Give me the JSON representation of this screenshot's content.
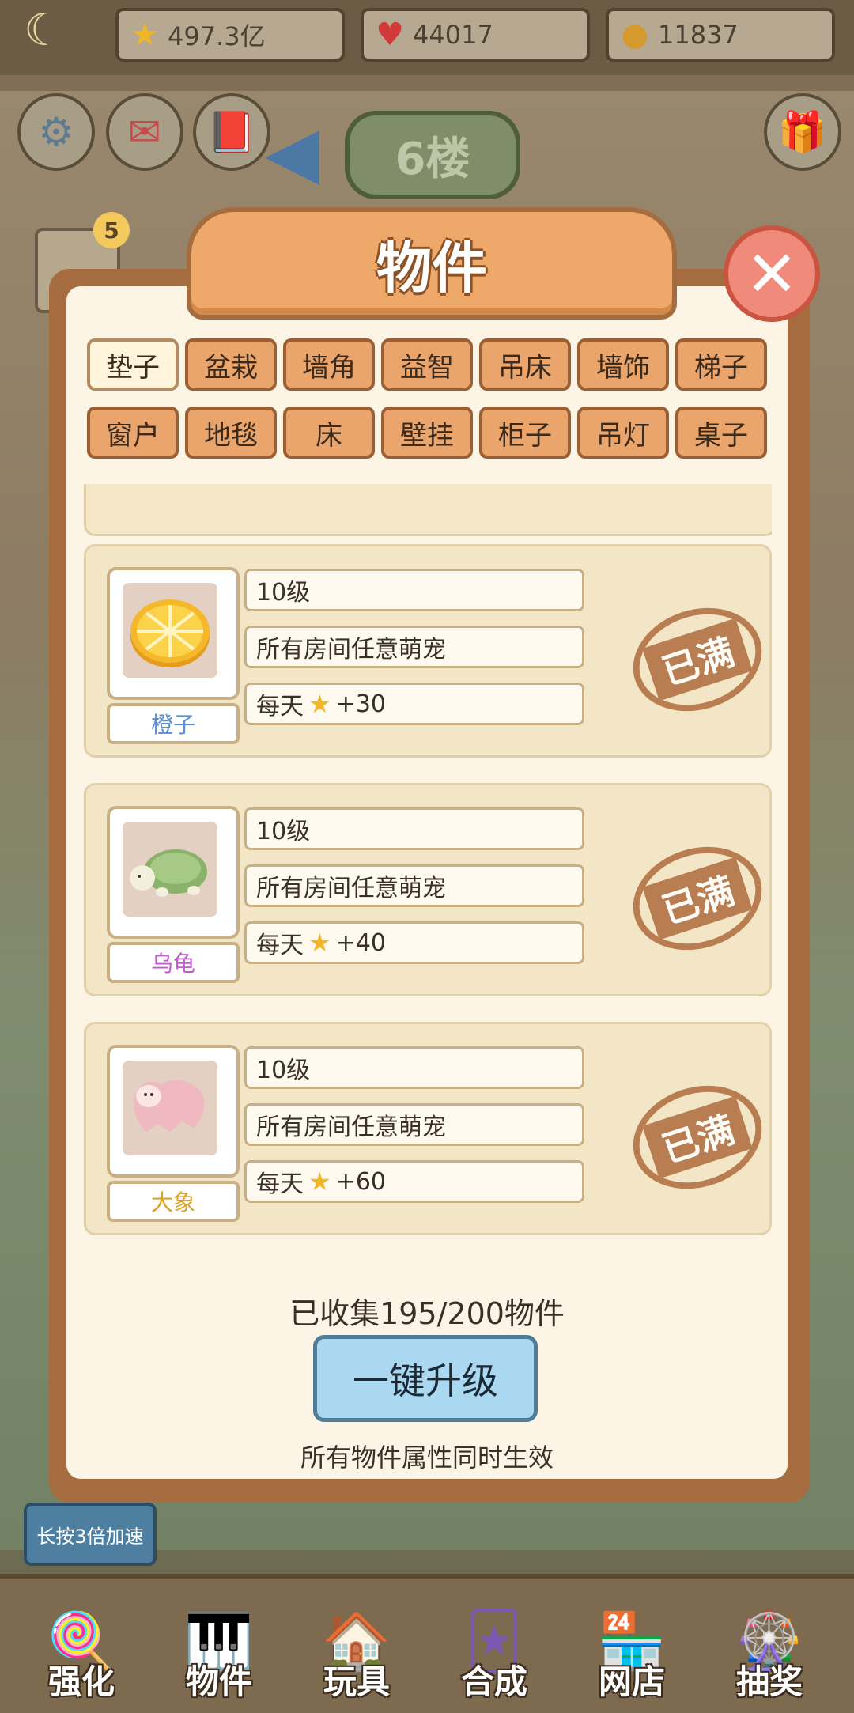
{
  "topbar": {
    "stars": "497.3亿",
    "hearts": "44017",
    "coins": "11837"
  },
  "floor_label": "6楼",
  "side_badge": "5",
  "modal": {
    "title": "物件",
    "tabs_row1": [
      "垫子",
      "盆栽",
      "墙角",
      "益智",
      "吊床",
      "墙饰",
      "梯子"
    ],
    "tabs_row2": [
      "窗户",
      "地毯",
      "床",
      "壁挂",
      "柜子",
      "吊灯",
      "桌子"
    ],
    "active_tab": "垫子",
    "items": [
      {
        "name": "橙子",
        "name_color": "#5a8fd0",
        "level": "10级",
        "scope": "所有房间任意萌宠",
        "daily_prefix": "每天",
        "daily_bonus": "+30",
        "stamp": "已满"
      },
      {
        "name": "乌龟",
        "name_color": "#c25ad0",
        "level": "10级",
        "scope": "所有房间任意萌宠",
        "daily_prefix": "每天",
        "daily_bonus": "+40",
        "stamp": "已满"
      },
      {
        "name": "大象",
        "name_color": "#e0a020",
        "level": "10级",
        "scope": "所有房间任意萌宠",
        "daily_prefix": "每天",
        "daily_bonus": "+60",
        "stamp": "已满"
      }
    ],
    "collected": "已收集195/200物件",
    "upgrade_button": "一键升级",
    "note": "所有物件属性同时生效"
  },
  "speed_badge": "长按3倍加速",
  "nav": [
    {
      "label": "强化",
      "icon": "lollipop-icon"
    },
    {
      "label": "物件",
      "icon": "piano-icon"
    },
    {
      "label": "玩具",
      "icon": "toy-house-icon"
    },
    {
      "label": "合成",
      "icon": "cards-icon"
    },
    {
      "label": "网店",
      "icon": "shop-icon"
    },
    {
      "label": "抽奖",
      "icon": "wheel-icon"
    }
  ]
}
